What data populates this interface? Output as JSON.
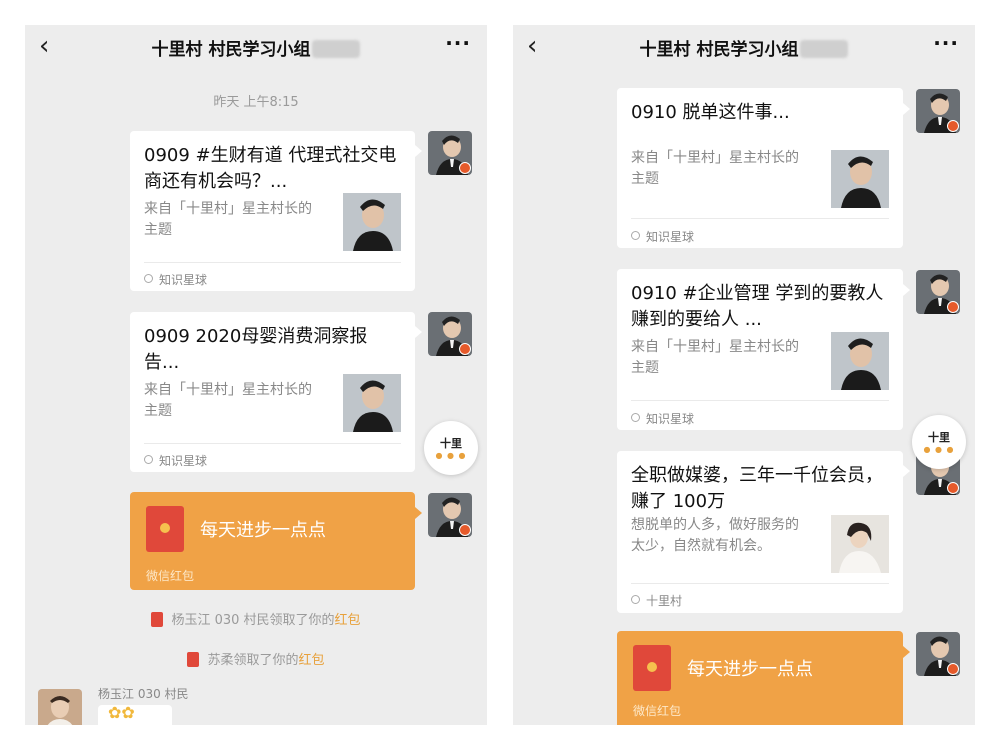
{
  "chat": {
    "title": "十里村 村民学习小组",
    "back_glyph": "‹",
    "more_glyph": "···"
  },
  "left": {
    "timestamp": "昨天 上午8:15",
    "card1": {
      "title": "0909 #生财有道 代理式社交电商还有机会吗？...",
      "desc": "来自「十里村」星主村长的主题",
      "source": "知识星球"
    },
    "card2": {
      "title": "0909 2020母婴消费洞察报告...",
      "desc": "来自「十里村」星主村长的主题",
      "source": "知识星球"
    },
    "redpacket": {
      "text": "每天进步一点点",
      "footer": "微信红包"
    },
    "sys1": {
      "before": "杨玉江 030 村民领取了你的",
      "link": "红包"
    },
    "sys2": {
      "before": "苏柔领取了你的",
      "link": "红包"
    },
    "sender": "杨玉江 030 村民"
  },
  "right": {
    "card1": {
      "title": "0910 脱单这件事...",
      "desc": "来自「十里村」星主村长的主题",
      "source": "知识星球"
    },
    "card2": {
      "title": "0910 #企业管理 学到的要教人 赚到的要给人 ...",
      "desc": "来自「十里村」星主村长的主题",
      "source": "知识星球"
    },
    "card3": {
      "title": "全职做媒婆，三年一千位会员，赚了 100万",
      "desc": "想脱单的人多，做好服务的太少，自然就有机会。",
      "source": "十里村"
    },
    "redpacket": {
      "text": "每天进步一点点",
      "footer": "微信红包"
    }
  },
  "float_widget": {
    "label": "十里"
  },
  "colors": {
    "bg": "#ededed",
    "redpacket": "#f0a246",
    "highlight": "#e8a13c"
  }
}
